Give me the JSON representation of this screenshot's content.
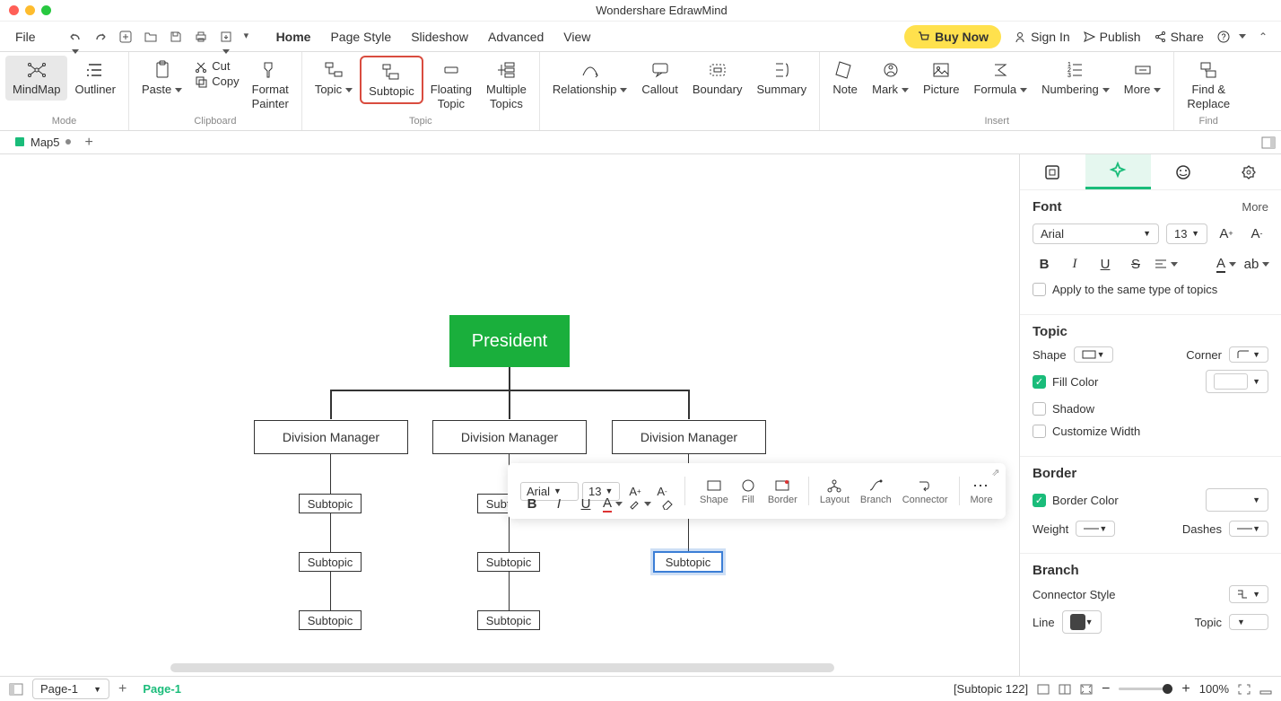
{
  "title": "Wondershare EdrawMind",
  "menu": {
    "file": "File",
    "tabs": [
      "Home",
      "Page Style",
      "Slideshow",
      "Advanced",
      "View"
    ],
    "active": "Home"
  },
  "header": {
    "buy": "Buy Now",
    "signin": "Sign In",
    "publish": "Publish",
    "share": "Share"
  },
  "ribbon": {
    "mode": {
      "label": "Mode",
      "mindmap": "MindMap",
      "outliner": "Outliner"
    },
    "clipboard": {
      "label": "Clipboard",
      "paste": "Paste",
      "cut": "Cut",
      "copy": "Copy",
      "format_painter": "Format\nPainter"
    },
    "topic": {
      "label": "Topic",
      "topic": "Topic",
      "subtopic": "Subtopic",
      "floating": "Floating\nTopic",
      "multiple": "Multiple\nTopics"
    },
    "other": {
      "relationship": "Relationship",
      "callout": "Callout",
      "boundary": "Boundary",
      "summary": "Summary"
    },
    "insert": {
      "label": "Insert",
      "note": "Note",
      "mark": "Mark",
      "picture": "Picture",
      "formula": "Formula",
      "numbering": "Numbering",
      "more": "More"
    },
    "find": {
      "label": "Find",
      "find_replace": "Find &\nReplace"
    }
  },
  "doc_tab": {
    "name": "Map5"
  },
  "chart": {
    "root": "President",
    "managers": [
      "Division Manager",
      "Division Manager",
      "Division Manager"
    ],
    "subtopic": "Subtopic",
    "selected_subtopic": "Subtopic"
  },
  "float": {
    "font": "Arial",
    "size": "13",
    "shape": "Shape",
    "fill": "Fill",
    "border": "Border",
    "layout": "Layout",
    "branch": "Branch",
    "connector": "Connector",
    "more": "More"
  },
  "side": {
    "font": {
      "title": "Font",
      "more": "More",
      "family": "Arial",
      "size": "13",
      "apply": "Apply to the same type of topics"
    },
    "topic": {
      "title": "Topic",
      "shape": "Shape",
      "corner": "Corner",
      "fill": "Fill Color",
      "shadow": "Shadow",
      "customize": "Customize Width"
    },
    "border": {
      "title": "Border",
      "color": "Border Color",
      "color_val": "#444444",
      "weight": "Weight",
      "dashes": "Dashes"
    },
    "branch": {
      "title": "Branch",
      "connector": "Connector Style",
      "line": "Line",
      "line_color": "#444444",
      "topic": "Topic"
    }
  },
  "status": {
    "page_dd": "Page-1",
    "page_tab": "Page-1",
    "selection": "[Subtopic 122]",
    "zoom": "100%"
  }
}
